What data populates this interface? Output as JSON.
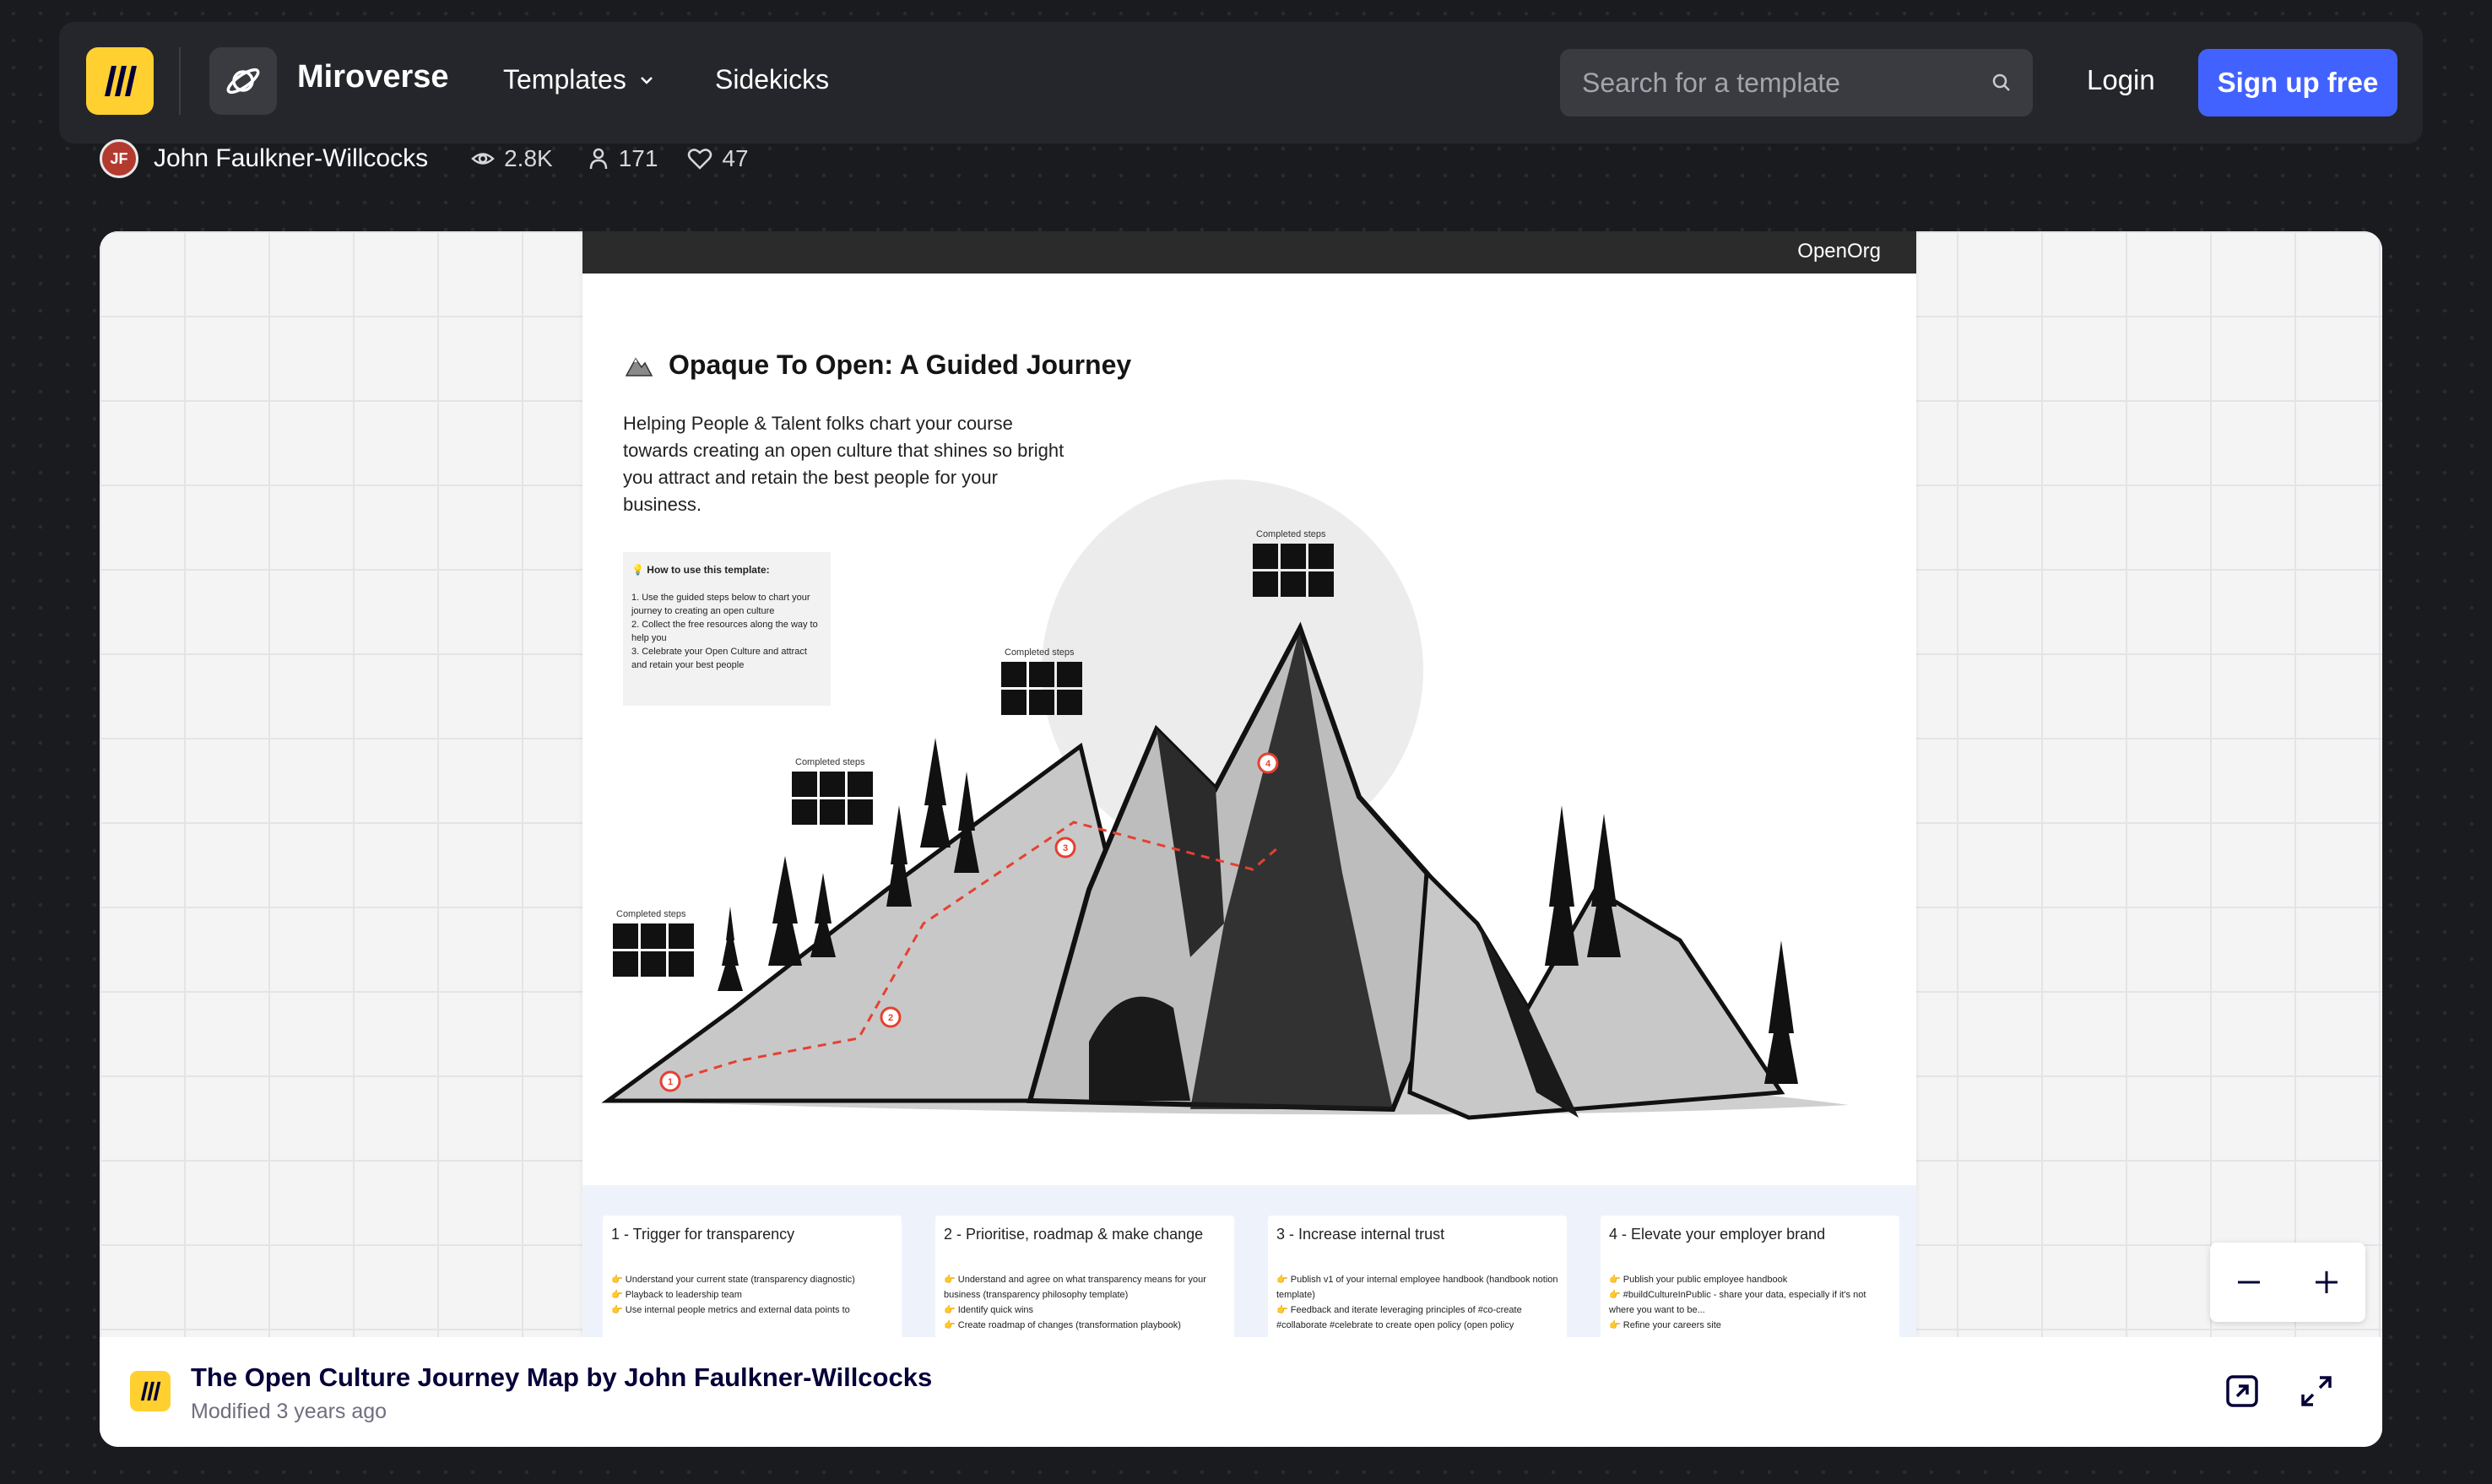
{
  "nav": {
    "brand": "Miroverse",
    "templates_label": "Templates",
    "sidekicks_label": "Sidekicks",
    "search_placeholder": "Search for a template",
    "login_label": "Login",
    "signup_label": "Sign up free",
    "signup_color": "#4262ff",
    "logo_color": "#ffd02f"
  },
  "meta": {
    "author": "John Faulkner-Willcocks",
    "views": "2.8K",
    "users": "171",
    "likes": "47"
  },
  "board": {
    "org": "OpenOrg",
    "title": "Opaque To Open: A Guided Journey",
    "description": "Helping People & Talent folks chart your course towards creating an open culture that shines so bright you attract and retain the best people for your business.",
    "howto_title": "How to use this template:",
    "howto_lines": [
      "1. Use the guided steps below to chart your journey to creating an open culture",
      "2. Collect the free resources along the way to help you",
      "3. Celebrate your Open Culture and attract and retain your best people"
    ],
    "completed_label": "Completed steps",
    "steps": [
      {
        "title": "1 - Trigger for transparency",
        "lines": [
          "👉 Understand your current state (transparency diagnostic)",
          "👉 Playback to leadership team",
          "👉 Use internal people metrics and external data points to"
        ]
      },
      {
        "title": "2 - Prioritise, roadmap & make change",
        "lines": [
          "👉 Understand and agree on what transparency means for your business (transparency philosophy template)",
          "👉 Identify quick wins",
          "👉 Create roadmap of changes (transformation playbook)"
        ]
      },
      {
        "title": "3 - Increase internal trust",
        "lines": [
          "👉 Publish v1 of your internal employee handbook (handbook notion template)",
          "👉 Feedback and iterate leveraging principles of #co-create #collaborate #celebrate to create open policy (open policy"
        ]
      },
      {
        "title": "4 - Elevate your employer brand",
        "lines": [
          "👉 Publish your public employee handbook",
          "👉 #buildCultureInPublic - share your data, especially if it's not where you want to be...",
          "👉 Refine your careers site"
        ]
      }
    ]
  },
  "footer": {
    "title": "The Open Culture Journey Map by John Faulkner-Willcocks",
    "modified": "Modified 3 years ago"
  }
}
